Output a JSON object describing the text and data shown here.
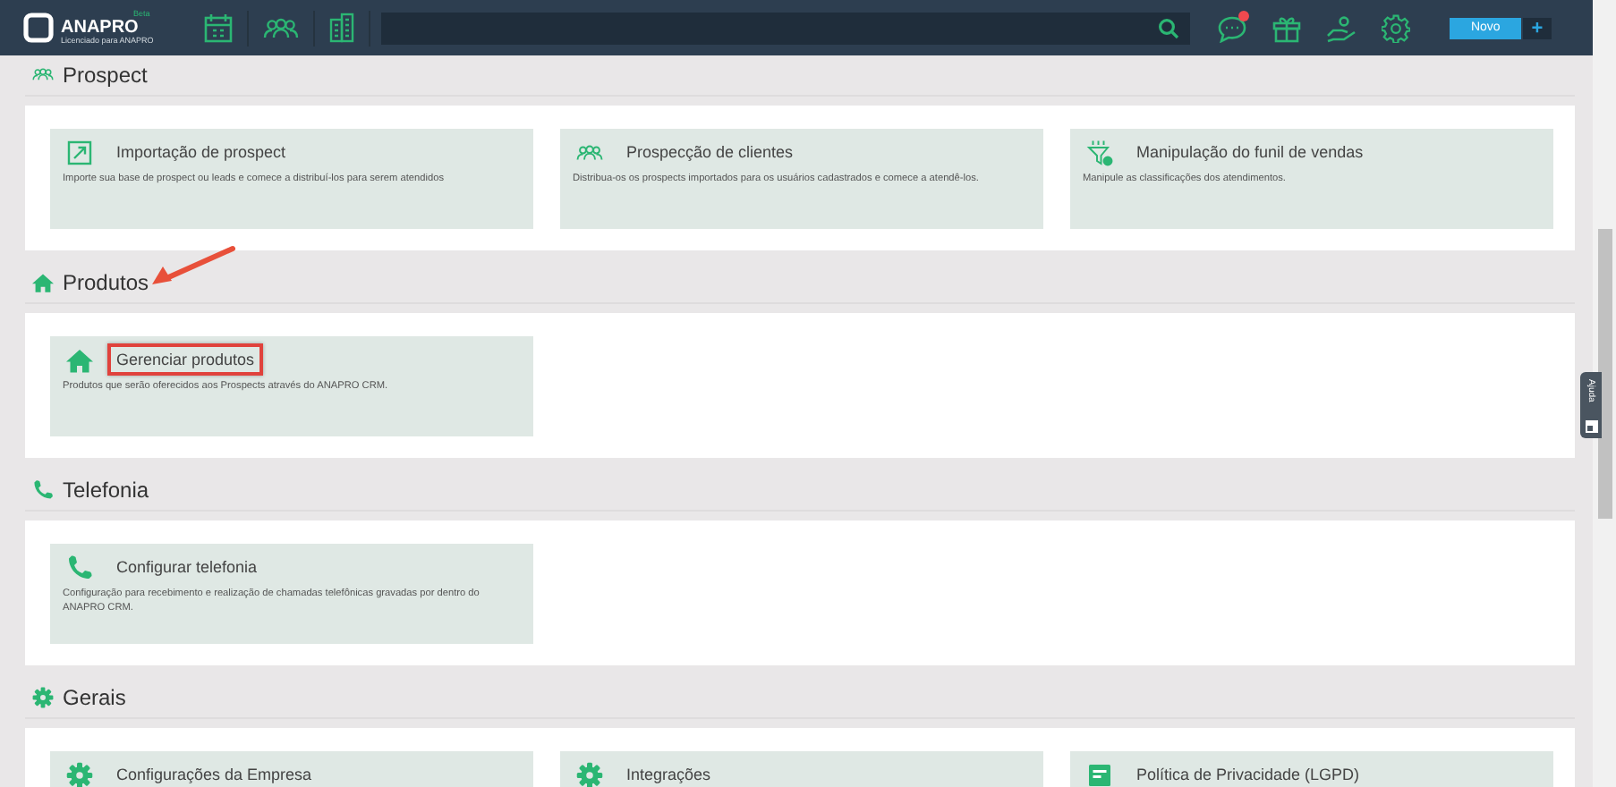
{
  "header": {
    "logo": {
      "name": "ANAPRO",
      "badge": "Beta",
      "subtitle": "Licenciado para ANAPRO"
    },
    "notification_dot": true,
    "new_button": "Novo",
    "add_button": "+"
  },
  "sections": [
    {
      "title": "Prospect",
      "cards": [
        {
          "title": "Importação de prospect",
          "description": "Importe sua base de prospect ou leads e comece a distribuí-los para serem atendidos",
          "highlighted": false
        },
        {
          "title": "Prospecção de clientes",
          "description": "Distribua-os os prospects importados para os usuários cadastrados e comece a atendê-los.",
          "highlighted": false
        },
        {
          "title": "Manipulação do funil de vendas",
          "description": "Manipule as classificações dos atendimentos.",
          "highlighted": false
        }
      ]
    },
    {
      "title": "Produtos",
      "cards": [
        {
          "title": "Gerenciar produtos",
          "description": "Produtos que serão oferecidos aos Prospects através do ANAPRO CRM.",
          "highlighted": true
        }
      ]
    },
    {
      "title": "Telefonia",
      "cards": [
        {
          "title": "Configurar telefonia",
          "description": "Configuração para recebimento e realização de chamadas telefônicas gravadas por dentro do ANAPRO CRM.",
          "highlighted": false
        }
      ]
    },
    {
      "title": "Gerais",
      "cards": [
        {
          "title": "Configurações da Empresa",
          "highlighted": false
        },
        {
          "title": "Integrações",
          "highlighted": false
        },
        {
          "title": "Política de Privacidade (LGPD)",
          "highlighted": false
        }
      ]
    }
  ],
  "help_tab": "Ajuda"
}
